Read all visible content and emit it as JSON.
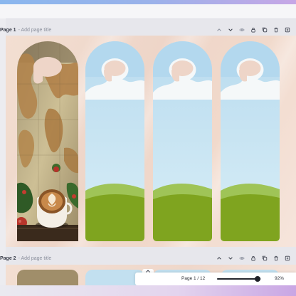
{
  "page1": {
    "title": "Page 1",
    "subtitle": "- Add page title"
  },
  "page2": {
    "title": "Page 2",
    "subtitle": "- Add page title"
  },
  "page_actions": [
    "chevron-up-icon",
    "chevron-down-icon",
    "eye-icon",
    "lock-icon",
    "duplicate-icon",
    "trash-icon",
    "add-page-icon"
  ],
  "footer": {
    "pager": "Page 1 / 12",
    "zoom_label": "92%",
    "zoom_level": 0.92
  },
  "colors": {
    "canvas_bg": "#f0d8ca",
    "sky": "#c9e5f2",
    "grass_light": "#9fc457",
    "grass_dark": "#7fa41f",
    "cloud": "#f5f8f9"
  }
}
